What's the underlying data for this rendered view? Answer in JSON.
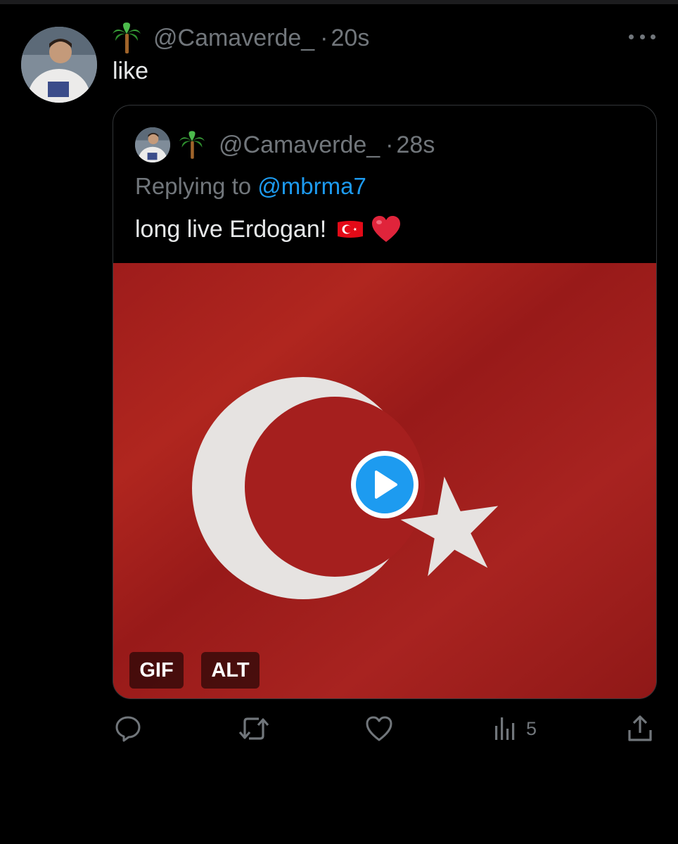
{
  "tweet": {
    "handle": "@Camaverde_",
    "separator": "·",
    "time": "20s",
    "text": "like",
    "avatar_icon": "user-avatar",
    "emoji_icon": "palm-tree-emoji"
  },
  "quoted_tweet": {
    "handle": "@Camaverde_",
    "separator": "·",
    "time": "28s",
    "replying_prefix": "Replying to ",
    "replying_to": "@mbrma7",
    "text": "long live Erdogan!",
    "emojis": [
      "turkey-flag-emoji",
      "red-heart-emoji"
    ],
    "media": {
      "badges": {
        "gif": "GIF",
        "alt": "ALT"
      },
      "play_icon": "play-icon"
    }
  },
  "actions": {
    "views_count": "5"
  },
  "colors": {
    "background": "#000000",
    "text": "#e7e9ea",
    "muted": "#71767b",
    "accent": "#1d9bf0",
    "border": "#333639",
    "flag_red": "#a51f1e"
  }
}
